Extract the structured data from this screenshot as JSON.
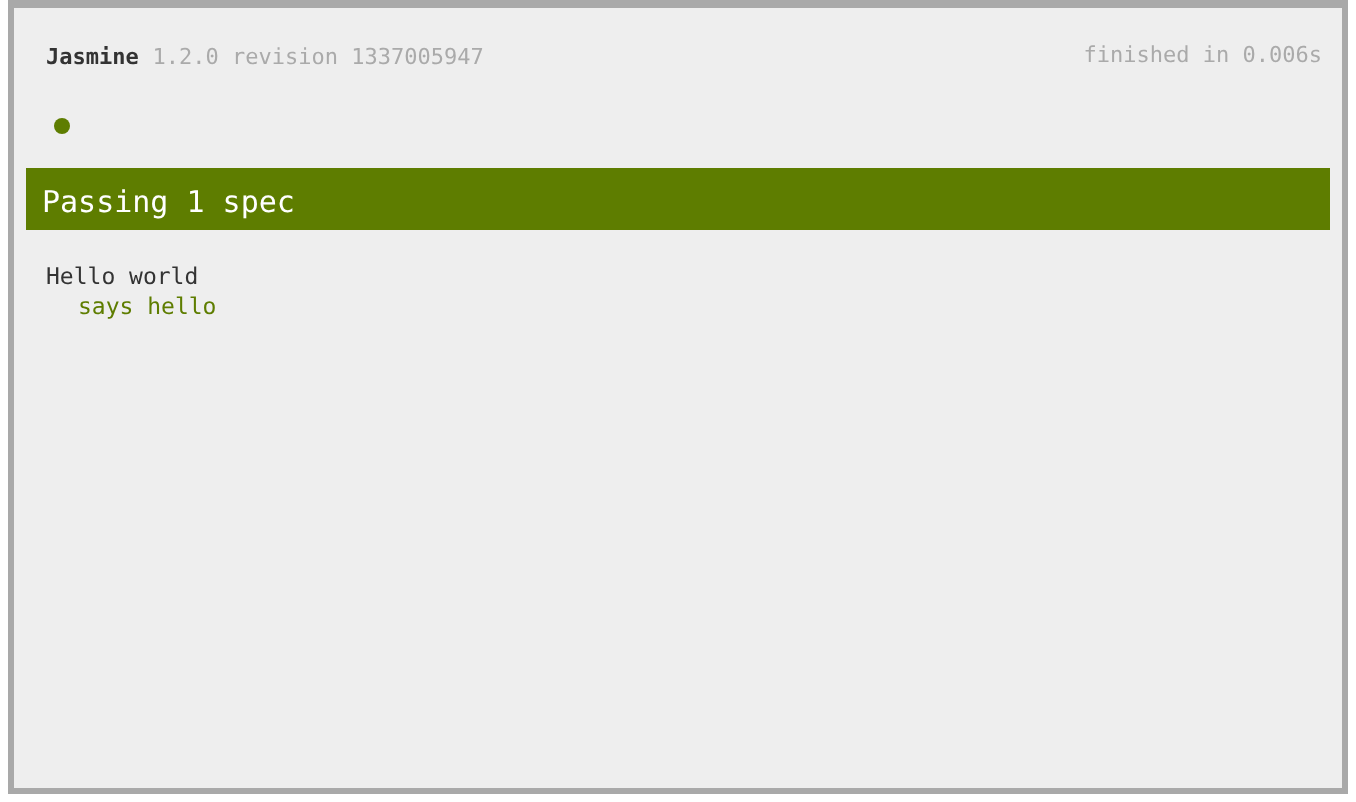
{
  "header": {
    "title": "Jasmine",
    "version": "1.2.0 revision 1337005947",
    "duration": "finished in 0.006s"
  },
  "spec_dots": [
    {
      "passed": true
    }
  ],
  "summary": {
    "text": "Passing 1 spec",
    "passed": true
  },
  "suites": [
    {
      "name": "Hello world",
      "specs": [
        {
          "name": "says hello",
          "passed": true
        }
      ]
    }
  ]
}
